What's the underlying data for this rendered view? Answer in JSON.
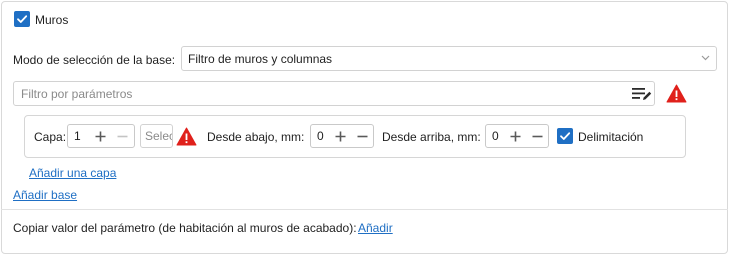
{
  "muros_checkbox": {
    "label": "Muros",
    "checked": true
  },
  "base_mode": {
    "label": "Modo de selección de la base:",
    "selected": "Filtro de muros y columnas"
  },
  "param_filter": {
    "placeholder": "Filtro por parámetros",
    "edit_icon": "edit-list-icon",
    "warning_icon": "warning-icon"
  },
  "layer": {
    "capa_label": "Capa:",
    "capa_value": "1",
    "select_placeholder": "Selec",
    "desde_abajo_label": "Desde abajo, mm:",
    "desde_abajo_value": "0",
    "desde_arriba_label": "Desde arriba, mm:",
    "desde_arriba_value": "0",
    "delimitacion_label": "Delimitación",
    "delimitacion_checked": true
  },
  "links": {
    "add_layer": "Añadir una capa",
    "add_base": "Añadir base"
  },
  "copy_param": {
    "label": "Copiar valor del parámetro (de habitación al muros de acabado):",
    "add_link": "Añadir"
  },
  "colors": {
    "accent": "#1f6fc4",
    "warning": "#e0201b",
    "border": "#d2d2d2"
  }
}
